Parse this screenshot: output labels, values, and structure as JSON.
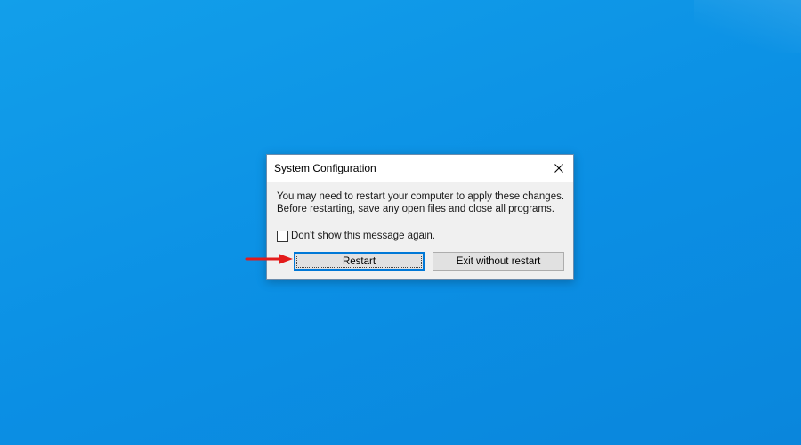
{
  "dialog": {
    "title": "System Configuration",
    "message_line1": "You may need to restart your computer to apply these changes.",
    "message_line2": "Before restarting, save any open files and close all programs.",
    "checkbox_label": "Don't show this message again.",
    "checkbox_checked": false,
    "restart_label": "Restart",
    "exit_label": "Exit without restart"
  },
  "icons": {
    "close": "close-icon",
    "annotation_arrow": "red-arrow-icon"
  },
  "colors": {
    "desktop": "#0b8fe4",
    "accent": "#0078d7",
    "arrow": "#e31b1b"
  }
}
